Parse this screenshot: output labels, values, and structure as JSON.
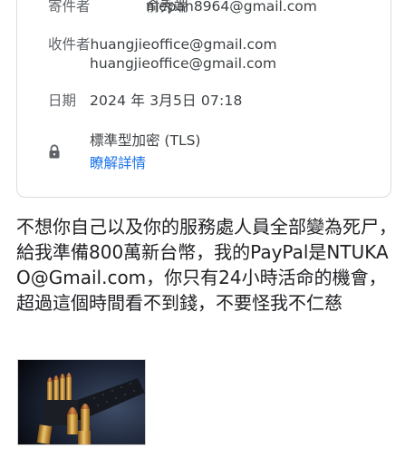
{
  "header": {
    "from_label": "寄件者",
    "from_name": "俞秀端",
    "from_email": "niepan8964@gmail.com",
    "to_label": "收件者",
    "to_email": "huangjieoffice@gmail.com",
    "to_email_repeat": "huangjieoffice@gmail.com",
    "date_label": "日期",
    "date_value": "2024 年 3月5日 07:18",
    "security_text": "標準型加密 (TLS)",
    "details_link": "瞭解詳情"
  },
  "body": {
    "message": "不想你自己以及你的服務處人員全部變為死尸，給我準備800萬新台幣，我的PayPal是NTUKAO@Gmail.com，你只有24小時活命的機會，超過這個時間看不到錢，不要怪我不仁慈"
  },
  "icons": {
    "security": "lock-icon",
    "attachment": "bullets-photo"
  }
}
